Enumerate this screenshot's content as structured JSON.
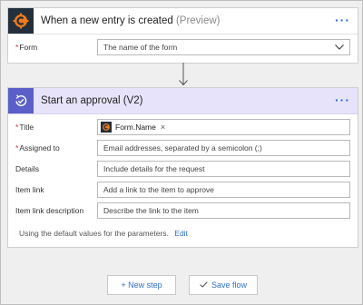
{
  "trigger": {
    "title": "When a new entry is created",
    "title_suffix": "(Preview)",
    "more_label": "···",
    "icon": "cognito-forms-icon",
    "form_field": {
      "label": "Form",
      "required_mark": "*",
      "value": "The name of the form"
    }
  },
  "approval": {
    "title": "Start an approval (V2)",
    "more_label": "···",
    "icon": "approval-icon",
    "fields": {
      "title": {
        "label": "Title",
        "required_mark": "*",
        "token": "Form.Name",
        "token_remove": "×"
      },
      "assigned_to": {
        "label": "Assigned to",
        "required_mark": "*",
        "placeholder": "Email addresses, separated by a semicolon (;)"
      },
      "details": {
        "label": "Details",
        "placeholder": "Include details for the request"
      },
      "item_link": {
        "label": "Item link",
        "placeholder": "Add a link to the item to approve"
      },
      "item_link_description": {
        "label": "Item link description",
        "placeholder": "Describe the link to the item"
      }
    },
    "footer_text": "Using the default values for the parameters.",
    "edit_label": "Edit"
  },
  "actions": {
    "new_step_label": "+ New step",
    "save_flow_label": "Save flow"
  },
  "colors": {
    "accent": "#2b6fc7",
    "approval_header": "#e7e3fb",
    "approval_icon_bg": "#5b5fc7",
    "cognito_icon_bg": "#23303c",
    "required": "#d13438"
  }
}
